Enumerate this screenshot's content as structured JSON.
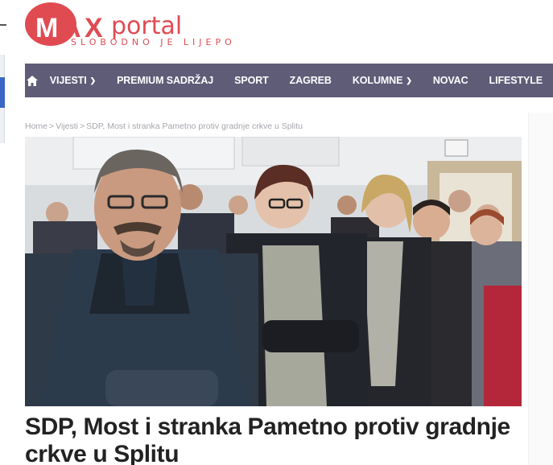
{
  "site": {
    "logo_text": "MAXportal",
    "tagline": "SLOBODNO JE LIJEPO",
    "brand_color": "#e04b52",
    "nav_color": "#5f5c78"
  },
  "nav": {
    "home_icon": "home-icon",
    "items": [
      {
        "label": "VIJESTI",
        "has_dropdown": true
      },
      {
        "label": "PREMIUM SADRŽAJ",
        "has_dropdown": false
      },
      {
        "label": "SPORT",
        "has_dropdown": false
      },
      {
        "label": "ZAGREB",
        "has_dropdown": false
      },
      {
        "label": "KOLUMNE",
        "has_dropdown": true
      },
      {
        "label": "NOVAC",
        "has_dropdown": false
      },
      {
        "label": "LIFESTYLE",
        "has_dropdown": false
      }
    ]
  },
  "breadcrumb": {
    "home": "Home",
    "section": "Vijesti",
    "current": "SDP, Most i stranka Pametno protiv gradnje crkve u Splitu",
    "separator": ">"
  },
  "article": {
    "headline": "SDP, Most i stranka Pametno protiv gradnje crkve u Splitu"
  }
}
